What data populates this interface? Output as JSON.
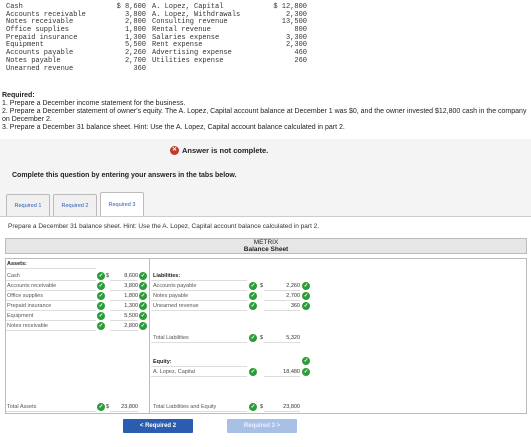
{
  "trial_balance": [
    {
      "l1": "Cash",
      "v1": "$ 8,600",
      "l2": "A. Lopez, Capital",
      "v2": "$ 12,800"
    },
    {
      "l1": "Accounts receivable",
      "v1": "3,800",
      "l2": "A. Lopez, Withdrawals",
      "v2": "2,300"
    },
    {
      "l1": "Notes receivable",
      "v1": "2,800",
      "l2": "Consulting revenue",
      "v2": "13,500"
    },
    {
      "l1": "Office supplies",
      "v1": "1,800",
      "l2": "Rental revenue",
      "v2": "800"
    },
    {
      "l1": "Prepaid insurance",
      "v1": "1,300",
      "l2": "Salaries expense",
      "v2": "3,300"
    },
    {
      "l1": "Equipment",
      "v1": "5,500",
      "l2": "Rent expense",
      "v2": "2,300"
    },
    {
      "l1": "Accounts payable",
      "v1": "2,260",
      "l2": "Advertising expense",
      "v2": "460"
    },
    {
      "l1": "Notes payable",
      "v1": "2,700",
      "l2": "Utilities expense",
      "v2": "260"
    },
    {
      "l1": "Unearned revenue",
      "v1": "360",
      "l2": "",
      "v2": ""
    }
  ],
  "required": {
    "title": "Required:",
    "line1": "1. Prepare a December income statement for the business.",
    "line2": "2. Prepare a December statement of owner's equity. The A. Lopez, Capital account balance at December 1 was $0, and the owner invested $12,800 cash in the company on December 2.",
    "line3": "3. Prepare a December 31 balance sheet. Hint: Use the A. Lopez, Capital account balance calculated in part 2."
  },
  "status": {
    "icon": "x-circle-icon",
    "text": "Answer is not complete."
  },
  "instruction": "Complete this question by entering your answers in the tabs below.",
  "tabs": [
    {
      "label": "Required 1"
    },
    {
      "label": "Required 2"
    },
    {
      "label": "Required 3"
    }
  ],
  "panel_prompt": "Prepare a December 31 balance sheet. Hint: Use the A. Lopez, Capital account balance calculated in part 2.",
  "sheet": {
    "company": "METRIX",
    "title": "Balance Sheet",
    "assets_header": "Assets:",
    "assets": [
      {
        "label": "Cash",
        "value": "8,600",
        "dollar": "$"
      },
      {
        "label": "Accounts receivable",
        "value": "3,800",
        "dollar": ""
      },
      {
        "label": "Office supplies",
        "value": "1,800",
        "dollar": ""
      },
      {
        "label": "Prepaid insurance",
        "value": "1,300",
        "dollar": ""
      },
      {
        "label": "Equipment",
        "value": "5,500",
        "dollar": ""
      },
      {
        "label": "Notes receivable",
        "value": "2,800",
        "dollar": ""
      }
    ],
    "total_assets_label": "Total Assets",
    "total_assets_value": "23,800",
    "liabilities_header": "Liabilities:",
    "liabilities": [
      {
        "label": "Accounts payable",
        "value": "2,260",
        "dollar": "$"
      },
      {
        "label": "Notes payable",
        "value": "2,700",
        "dollar": ""
      },
      {
        "label": "Unearned revenue",
        "value": "360",
        "dollar": ""
      }
    ],
    "total_liabilities_label": "Total Liabilities",
    "total_liabilities_value": "5,320",
    "equity_header": "Equity:",
    "equity_label": "A. Lopez, Capital",
    "equity_value": "18,480",
    "total_le_label": "Total Liabilities and Equity",
    "total_le_value": "23,800"
  },
  "nav": {
    "prev": "< Required 2",
    "next": "Required 3 >"
  },
  "colors": {
    "check": "#2a9d3a",
    "error": "#c0392b",
    "accent": "#2a5db0"
  }
}
